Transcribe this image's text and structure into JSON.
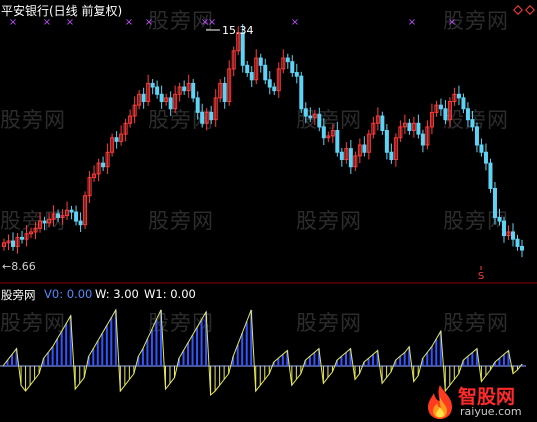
{
  "title": "平安银行(日线 前复权)",
  "watermark": "股旁网",
  "logo": {
    "name": "智股网",
    "url": "raiyue.com"
  },
  "colors": {
    "up": "#ff3b3b",
    "down": "#5fd3f3",
    "purple": "#c050ff",
    "hist_blue": "#3355ff",
    "hist_yellow": "#e8e85a",
    "zero_line": "#9ab0ff",
    "divider": "#8c0000"
  },
  "chart_data": [
    {
      "type": "candlestick",
      "title": "平安银行(日线 前复权)",
      "annotations": {
        "high_label": "15.34",
        "low_label": "8.66",
        "low_prefix": "←"
      },
      "y_min": 8.66,
      "y_max": 15.34,
      "closes": [
        9.3,
        9.35,
        9.2,
        9.45,
        9.4,
        9.55,
        9.6,
        9.7,
        9.9,
        9.85,
        9.95,
        10.1,
        10.0,
        10.05,
        10.2,
        10.15,
        9.9,
        9.8,
        10.6,
        11.1,
        11.2,
        11.5,
        11.4,
        11.8,
        12.2,
        12.1,
        12.3,
        12.6,
        12.8,
        13.1,
        13.4,
        13.2,
        13.7,
        13.6,
        13.4,
        13.2,
        13.3,
        13.0,
        13.4,
        13.6,
        13.5,
        13.7,
        13.3,
        12.9,
        12.6,
        12.9,
        12.7,
        13.3,
        13.7,
        13.2,
        14.1,
        14.6,
        15.1,
        14.2,
        14.0,
        13.8,
        14.4,
        14.2,
        13.8,
        13.6,
        13.5,
        14.1,
        14.4,
        14.3,
        14.0,
        13.9,
        13.0,
        12.8,
        12.75,
        12.85,
        12.5,
        12.2,
        12.25,
        12.4,
        11.8,
        11.6,
        11.9,
        11.4,
        11.7,
        12.0,
        11.8,
        12.3,
        12.6,
        12.8,
        12.4,
        11.8,
        11.6,
        12.2,
        12.5,
        12.6,
        12.4,
        12.6,
        12.3,
        12.0,
        12.5,
        12.9,
        13.1,
        13.0,
        12.7,
        13.2,
        13.4,
        13.3,
        13.0,
        12.7,
        12.5,
        12.0,
        11.8,
        11.5,
        10.8,
        10.0,
        9.9,
        9.5,
        9.6,
        9.4,
        9.2,
        9.1
      ]
    },
    {
      "type": "bar",
      "title": "股旁网",
      "series": [
        {
          "name": "V0",
          "value_label": "0.00"
        },
        {
          "name": "W",
          "value_label": "3.00"
        },
        {
          "name": "W1",
          "value_label": "0.00"
        }
      ],
      "values": [
        0,
        6,
        12,
        18,
        -20,
        -26,
        -20,
        -14,
        -8,
        8,
        14,
        20,
        28,
        36,
        44,
        52,
        -24,
        -18,
        -12,
        10,
        18,
        26,
        34,
        42,
        50,
        58,
        -26,
        -20,
        -14,
        -8,
        10,
        18,
        28,
        38,
        48,
        58,
        -24,
        -18,
        -12,
        8,
        16,
        24,
        32,
        40,
        48,
        56,
        -30,
        -26,
        -20,
        -14,
        -8,
        10,
        22,
        34,
        46,
        58,
        -26,
        -20,
        -14,
        -8,
        4,
        8,
        12,
        16,
        -20,
        -14,
        -8,
        6,
        10,
        14,
        18,
        -18,
        -12,
        -6,
        6,
        10,
        14,
        18,
        -14,
        -8,
        4,
        8,
        12,
        16,
        -18,
        -12,
        -6,
        6,
        10,
        14,
        20,
        -16,
        -10,
        8,
        14,
        20,
        28,
        36,
        -26,
        -20,
        -14,
        -8,
        6,
        10,
        14,
        18,
        -16,
        -10,
        -4,
        4,
        8,
        12,
        16,
        -8,
        -4,
        2
      ],
      "ylim": [
        -30,
        60
      ]
    }
  ]
}
